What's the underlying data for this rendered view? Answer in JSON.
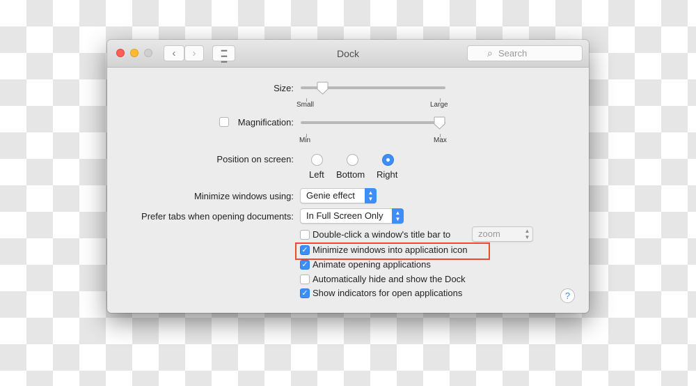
{
  "window": {
    "title": "Dock",
    "search_placeholder": "Search"
  },
  "toolbar": {
    "back_icon": "chevron-left-icon",
    "forward_icon": "chevron-right-icon",
    "grid_icon": "grid-icon",
    "search_icon": "magnifier-icon"
  },
  "size": {
    "label": "Size:",
    "min_label": "Small",
    "max_label": "Large",
    "value_fraction": 0.15
  },
  "magnification": {
    "label": "Magnification:",
    "checked": false,
    "min_label": "Min",
    "max_label": "Max",
    "value_fraction": 0.96
  },
  "position": {
    "label": "Position on screen:",
    "options": [
      {
        "label": "Left",
        "selected": false
      },
      {
        "label": "Bottom",
        "selected": false
      },
      {
        "label": "Right",
        "selected": true
      }
    ]
  },
  "minimize": {
    "label": "Minimize windows using:",
    "value": "Genie effect"
  },
  "prefer_tabs": {
    "label": "Prefer tabs when opening documents:",
    "value": "In Full Screen Only"
  },
  "checkboxes": [
    {
      "label": "Double-click a window's title bar to",
      "checked": false,
      "select_value": "zoom"
    },
    {
      "label": "Minimize windows into application icon",
      "checked": true
    },
    {
      "label": "Animate opening applications",
      "checked": true
    },
    {
      "label": "Automatically hide and show the Dock",
      "checked": false
    },
    {
      "label": "Show indicators for open applications",
      "checked": true
    }
  ],
  "help": "?",
  "colors": {
    "accent": "#3d8ef7",
    "highlight": "#ee4a2c"
  }
}
